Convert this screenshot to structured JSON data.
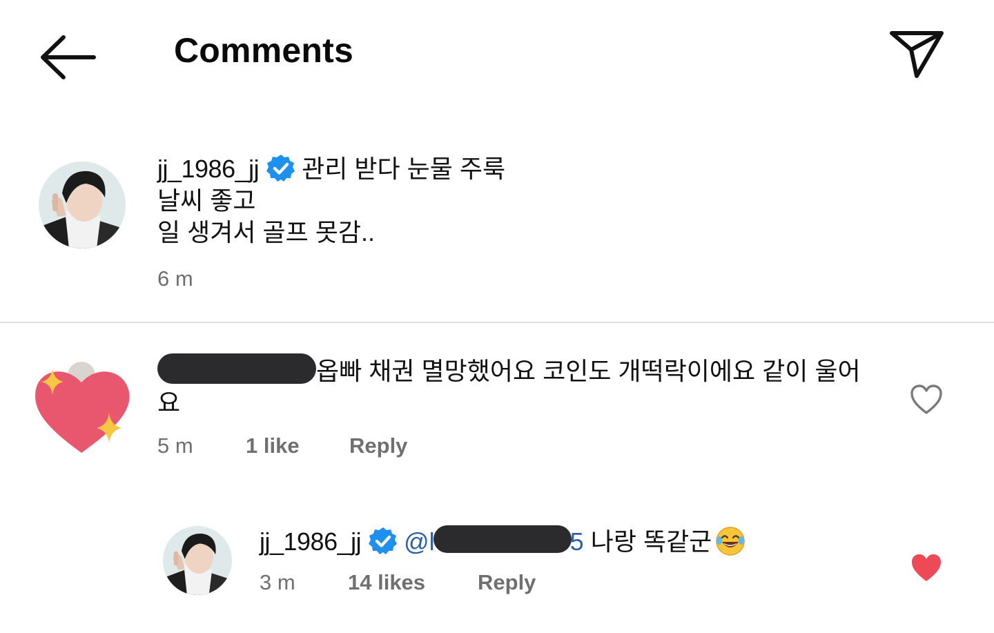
{
  "header": {
    "title": "Comments",
    "back_icon": "arrow-left-icon",
    "share_icon": "send-paper-plane-icon"
  },
  "caption": {
    "username": "jj_1986_jj",
    "verified_icon": "verified-badge-icon",
    "lines": [
      "관리 받다 눈물 주룩",
      "날씨 좋고",
      "일 생겨서 골프 못감.."
    ],
    "time": "6 m"
  },
  "comments": [
    {
      "avatar_icon": "sparkling-heart-icon",
      "text": "옵빠 채권 멸망했어요 코인도 개떡락이에요 같이 울어요",
      "time": "5 m",
      "likes": "1 like",
      "reply_label": "Reply",
      "liked": false,
      "like_icon": "heart-outline-icon"
    }
  ],
  "reply": {
    "username": "jj_1986_jj",
    "verified_icon": "verified-badge-icon",
    "mention_prefix": "@l",
    "mention_suffix": "5",
    "text": " 나랑 똑같군",
    "emoji_icon": "laughing-tears-emoji-icon",
    "time": "3 m",
    "likes": "14 likes",
    "reply_label": "Reply",
    "liked": true,
    "like_icon": "heart-filled-icon"
  },
  "colors": {
    "verified": "#1e90f0",
    "liked_heart": "#ed4956",
    "meta_text": "#6f6f6f",
    "mention": "#2b5fa6",
    "divider": "#dedede"
  }
}
